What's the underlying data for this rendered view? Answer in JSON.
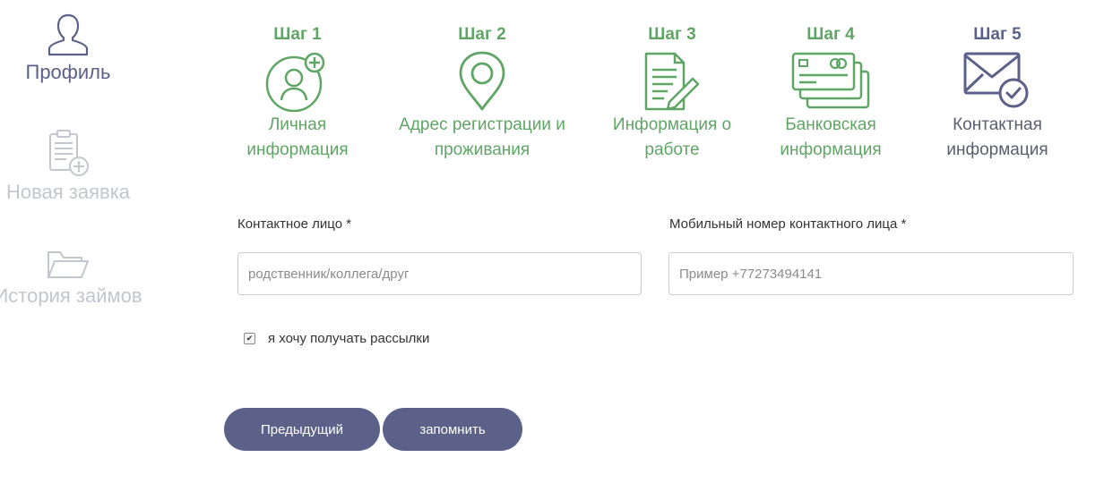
{
  "sidebar": {
    "items": [
      {
        "label": "Профиль",
        "icon": "user-icon",
        "active": true
      },
      {
        "label": "Новая заявка",
        "icon": "clipboard-add-icon",
        "active": false
      },
      {
        "label": "История займов",
        "icon": "folder-icon",
        "active": false
      }
    ]
  },
  "steps": [
    {
      "title": "Шаг 1",
      "label_line1": "Личная",
      "label_line2": "информация",
      "icon": "user-add-icon",
      "state": "done"
    },
    {
      "title": "Шаг 2",
      "label_line1": "Адрес регистрации и",
      "label_line2": "проживания",
      "icon": "location-pin-icon",
      "state": "done"
    },
    {
      "title": "Шаг 3",
      "label_line1": "Информация о",
      "label_line2": "работе",
      "icon": "document-edit-icon",
      "state": "done"
    },
    {
      "title": "Шаг 4",
      "label_line1": "Банковская",
      "label_line2": "информация",
      "icon": "bank-cards-icon",
      "state": "done"
    },
    {
      "title": "Шаг 5",
      "label_line1": "Контактная",
      "label_line2": "информация",
      "icon": "envelope-check-icon",
      "state": "current"
    }
  ],
  "form": {
    "contact_person": {
      "label": "Контактное лицо *",
      "placeholder": "родственник/коллега/друг",
      "value": ""
    },
    "contact_phone": {
      "label": "Мобильный номер контактного лица *",
      "placeholder": "Пример +77273494141",
      "value": ""
    },
    "newsletter": {
      "label": "я хочу получать рассылки",
      "checked": true
    }
  },
  "buttons": {
    "previous": "Предыдущий",
    "save": "запомнить"
  },
  "colors": {
    "accent": "#5b6188",
    "done_green": "#5fa565",
    "inactive_gray": "#c4c6ce"
  }
}
